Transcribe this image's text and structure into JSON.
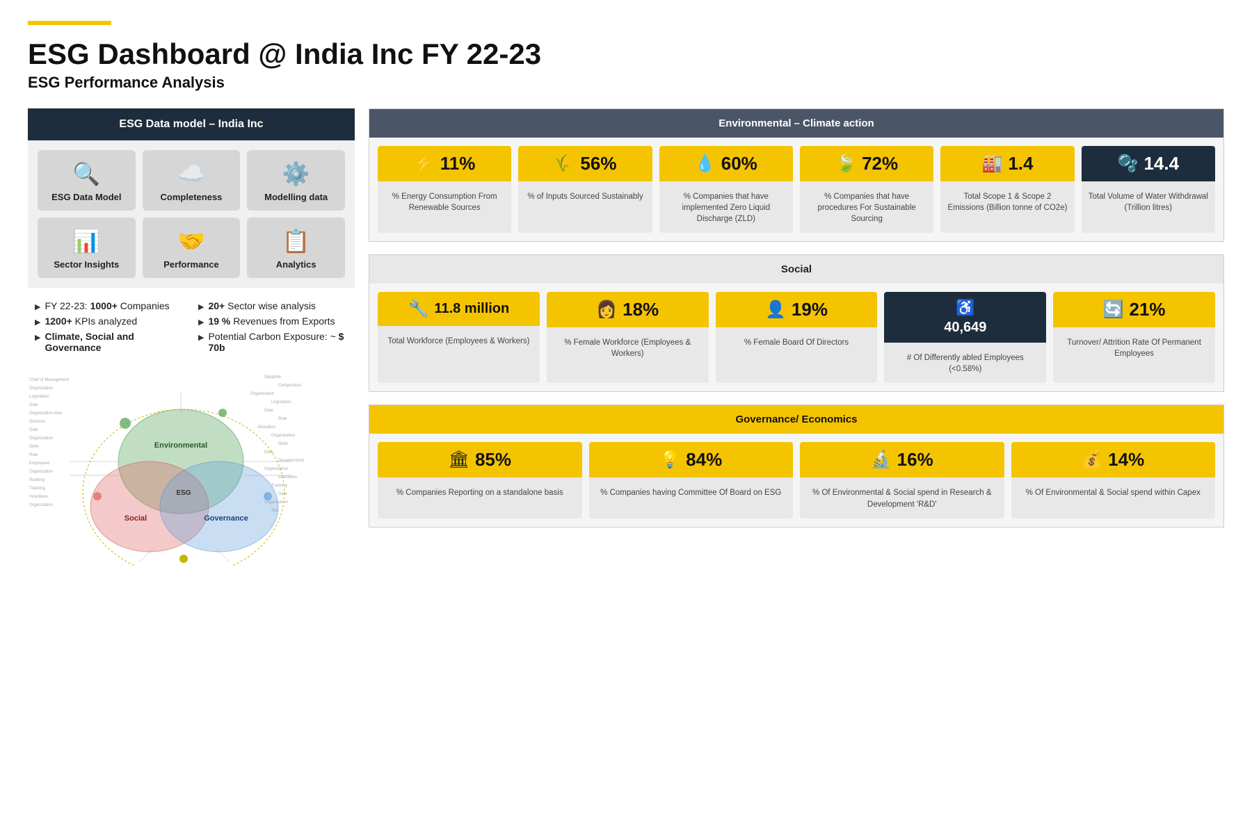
{
  "header": {
    "title": "ESG Dashboard @ India Inc FY 22-23",
    "subtitle": "ESG Performance Analysis"
  },
  "left_panel": {
    "header": "ESG Data model – India Inc",
    "cards": [
      {
        "id": "esg-data-model",
        "label": "ESG Data Model",
        "icon": "🔍"
      },
      {
        "id": "completeness",
        "label": "Completeness",
        "icon": "☁"
      },
      {
        "id": "modelling-data",
        "label": "Modelling data",
        "icon": "⚙"
      },
      {
        "id": "sector-insights",
        "label": "Sector Insights",
        "icon": "📊"
      },
      {
        "id": "performance",
        "label": "Performance",
        "icon": "🤝"
      },
      {
        "id": "analytics",
        "label": "Analytics",
        "icon": "📋"
      }
    ],
    "bullets_col1": [
      {
        "text": "FY 22-23: ",
        "bold": "1000+",
        "rest": " Companies"
      },
      {
        "text": "",
        "bold": "1200+",
        "rest": " KPIs analyzed"
      },
      {
        "text": "",
        "bold": "Climate, Social and Governance",
        "rest": ""
      }
    ],
    "bullets_col2": [
      {
        "text": "",
        "bold": "20+",
        "rest": " Sector wise analysis"
      },
      {
        "text": "",
        "bold": "19 %",
        "rest": " Revenues from Exports"
      },
      {
        "text": "Potential Carbon Exposure: ~ ",
        "bold": "$ 70b",
        "rest": ""
      }
    ]
  },
  "environmental": {
    "header": "Environmental – Climate action",
    "metrics": [
      {
        "icon": "⚡",
        "value": "11%",
        "label": "% Energy Consumption From Renewable Sources"
      },
      {
        "icon": "🌾",
        "value": "56%",
        "label": "% of Inputs Sourced Sustainably"
      },
      {
        "icon": "💧",
        "value": "60%",
        "label": "% Companies that have implemented Zero Liquid Discharge (ZLD)"
      },
      {
        "icon": "🍃",
        "value": "72%",
        "label": "% Companies that have procedures For Sustainable Sourcing"
      },
      {
        "icon": "🏭",
        "value": "1.4",
        "label": "Total Scope 1 & Scope 2 Emissions (Billion tonne of CO2e)"
      },
      {
        "icon": "🫧",
        "value": "14.4",
        "label": "Total Volume of Water Withdrawal (Trillion litres)"
      }
    ]
  },
  "social": {
    "header": "Social",
    "metrics": [
      {
        "icon": "🔧",
        "value": "11.8 million",
        "label": "Total Workforce (Employees & Workers)",
        "dark": false
      },
      {
        "icon": "👩",
        "value": "18%",
        "label": "% Female Workforce (Employees & Workers)",
        "dark": false
      },
      {
        "icon": "👤",
        "value": "19%",
        "label": "% Female Board Of Directors",
        "dark": false
      },
      {
        "icon": "♿",
        "value": "40,649",
        "sublabel": "# Of Differently abled Employees (<0.58%)",
        "dark": true
      },
      {
        "icon": "🔄",
        "value": "21%",
        "label": "Turnover/ Attrition Rate Of Permanent Employees",
        "dark": false
      }
    ]
  },
  "governance": {
    "header": "Governance/ Economics",
    "metrics": [
      {
        "icon": "🏛",
        "value": "85%",
        "label": "% Companies Reporting on a standalone basis"
      },
      {
        "icon": "💡",
        "value": "84%",
        "label": "% Companies having Committee Of Board on ESG"
      },
      {
        "icon": "🔬",
        "value": "16%",
        "label": "% Of Environmental & Social spend in Research & Development 'R&D'"
      },
      {
        "icon": "💰",
        "value": "14%",
        "label": "% Of Environmental & Social spend within Capex"
      }
    ]
  }
}
